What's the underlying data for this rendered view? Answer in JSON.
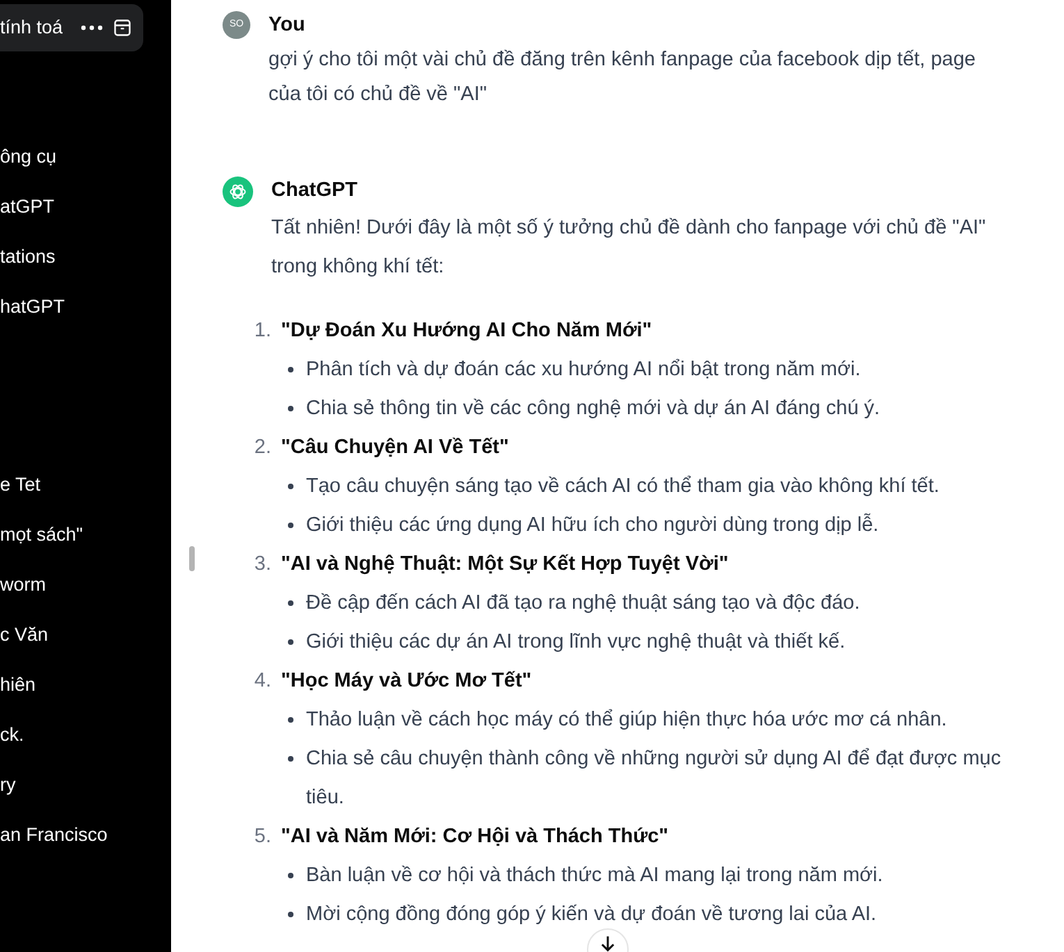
{
  "sidebar": {
    "active_chat": {
      "title": "tính toá"
    },
    "sections": [
      {
        "items": [
          {
            "label": "ông cụ"
          },
          {
            "label": "atGPT"
          },
          {
            "label": "tations"
          },
          {
            "label": "hatGPT"
          }
        ]
      },
      {
        "items": [
          {
            "label": "e Tet"
          },
          {
            "label": "mọt sách\""
          },
          {
            "label": "worm"
          },
          {
            "label": "c Văn"
          },
          {
            "label": "hiên"
          },
          {
            "label": "ck."
          },
          {
            "label": "ry"
          },
          {
            "label": "an Francisco"
          }
        ]
      }
    ]
  },
  "messages": [
    {
      "kind": "user",
      "author": "You",
      "avatar": "SO",
      "text": "gợi ý cho tôi một vài chủ đề đăng trên kênh fanpage của facebook dịp tết, page của tôi có chủ đề về \"AI\""
    },
    {
      "kind": "assistant",
      "author": "ChatGPT",
      "text": "Tất nhiên! Dưới đây là một số ý tưởng chủ đề dành cho fanpage với chủ đề \"AI\" trong không khí tết:",
      "list": [
        {
          "number": "1.",
          "title": "\"Dự Đoán Xu Hướng AI Cho Năm Mới\"",
          "bullets": [
            "Phân tích và dự đoán các xu hướng AI nổi bật trong năm mới.",
            "Chia sẻ thông tin về các công nghệ mới và dự án AI đáng chú ý."
          ]
        },
        {
          "number": "2.",
          "title": "\"Câu Chuyện AI Về Tết\"",
          "bullets": [
            "Tạo câu chuyện sáng tạo về cách AI có thể tham gia vào không khí tết.",
            "Giới thiệu các ứng dụng AI hữu ích cho người dùng trong dịp lễ."
          ]
        },
        {
          "number": "3.",
          "title": "\"AI và Nghệ Thuật: Một Sự Kết Hợp Tuyệt Vời\"",
          "bullets": [
            "Đề cập đến cách AI đã tạo ra nghệ thuật sáng tạo và độc đáo.",
            "Giới thiệu các dự án AI trong lĩnh vực nghệ thuật và thiết kế."
          ]
        },
        {
          "number": "4.",
          "title": "\"Học Máy và Ước Mơ Tết\"",
          "bullets": [
            "Thảo luận về cách học máy có thể giúp hiện thực hóa ước mơ cá nhân.",
            "Chia sẻ câu chuyện thành công về những người sử dụng AI để đạt được mục tiêu."
          ]
        },
        {
          "number": "5.",
          "title": "\"AI và Năm Mới: Cơ Hội và Thách Thức\"",
          "bullets": [
            "Bàn luận về cơ hội và thách thức mà AI mang lại trong năm mới.",
            "Mời cộng đồng đóng góp ý kiến và dự đoán về tương lai của AI."
          ]
        }
      ]
    }
  ]
}
